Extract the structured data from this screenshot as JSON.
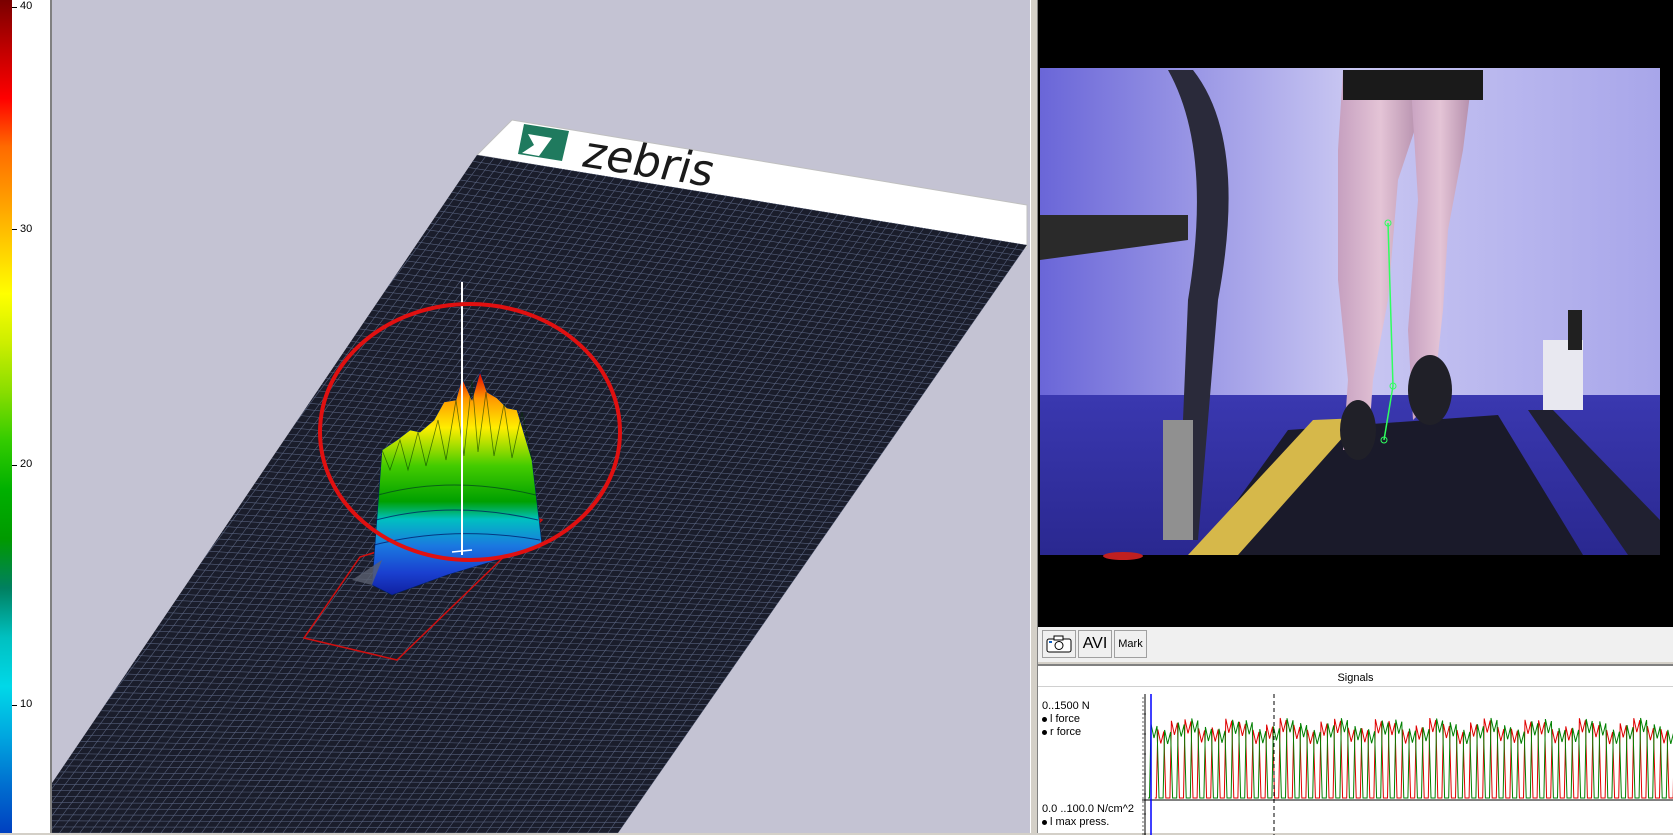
{
  "scale": {
    "ticks": [
      "40",
      "30",
      "20",
      "10"
    ],
    "colors": [
      "#7a0000",
      "#c00000",
      "#ff0000",
      "#ff6a00",
      "#ff9900",
      "#ffcc00",
      "#ffff00",
      "#ccee00",
      "#88dd00",
      "#33cc00",
      "#00b000",
      "#009a00",
      "#008060",
      "#00c0c0",
      "#00d8e8",
      "#00a8e0",
      "#0070d0",
      "#0040c0"
    ]
  },
  "view3d": {
    "logo_text": "zebris",
    "colors": {
      "background": "#c4c3d3",
      "plate": "#1a1d2b",
      "grid": "#56607c",
      "highlight_circle": "#e01010",
      "outline": "#d01010"
    }
  },
  "video": {
    "toolbar": {
      "camera_icon": "camera-icon",
      "avi_label": "AVI",
      "mark_label": "Mark"
    }
  },
  "signals": {
    "title": "Signals",
    "force": {
      "range_label": "0..1500 N",
      "l_label": "l force",
      "r_label": "r force"
    },
    "pressure": {
      "range_label": "0.0 ..100.0 N/cm^2",
      "l_label": "l max press."
    },
    "colors": {
      "l_force": "#008000",
      "r_force": "#e00000",
      "cursor": "#0000ff"
    }
  }
}
